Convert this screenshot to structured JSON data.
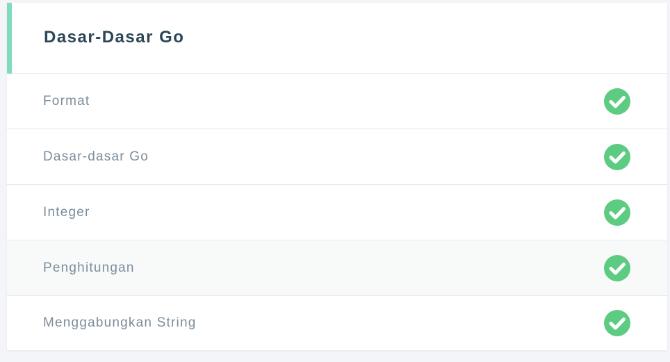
{
  "section": {
    "title": "Dasar-Dasar Go",
    "accent_color": "#7fdcc0",
    "lessons": [
      {
        "label": "Format",
        "status": "completed",
        "icon": "check-circle-icon"
      },
      {
        "label": "Dasar-dasar Go",
        "status": "completed",
        "icon": "check-circle-icon"
      },
      {
        "label": "Integer",
        "status": "completed",
        "icon": "check-circle-icon"
      },
      {
        "label": "Penghitungan",
        "status": "completed",
        "icon": "check-circle-icon"
      },
      {
        "label": "Menggabungkan String",
        "status": "completed",
        "icon": "check-circle-icon"
      }
    ]
  },
  "colors": {
    "check_green": "#5ecb82",
    "title_text": "#2b4656",
    "item_text": "#7b8d9c"
  }
}
